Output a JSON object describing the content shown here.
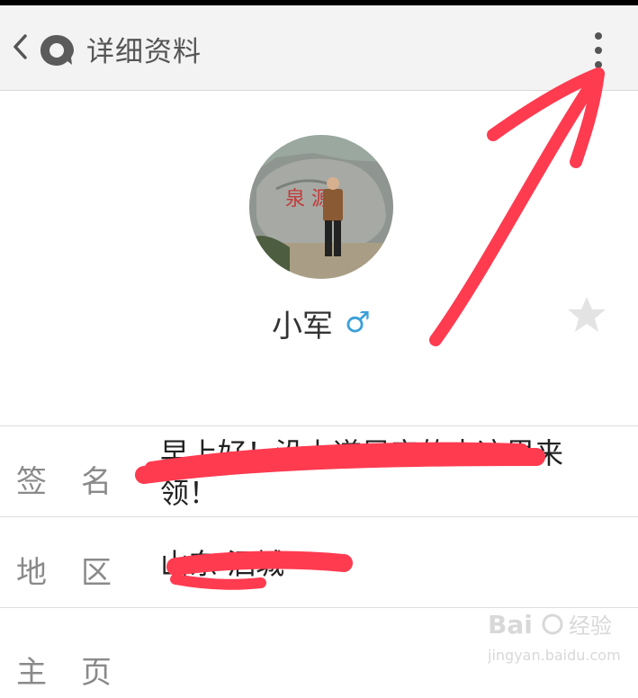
{
  "header": {
    "title": "详细资料",
    "back_icon": "chevron-left-icon",
    "logo_icon": "app-logo-icon",
    "more_icon": "more-vertical-icon"
  },
  "profile": {
    "name": "小军",
    "gender_symbol": "♂",
    "gender_color": "#3aa0d8",
    "favorite_icon": "star-icon"
  },
  "rows": [
    {
      "label": "签名",
      "value": "早上好！没上道早安的来这里来领！"
    },
    {
      "label": "地区",
      "value": "山东 泗城"
    },
    {
      "label": "主页",
      "value": ""
    }
  ],
  "annotation": {
    "arrow_color": "#ff3b50",
    "redaction_color": "#ff3b50"
  },
  "watermark": {
    "brand": "Bai 经验",
    "url": "jingyan.baidu.com"
  }
}
